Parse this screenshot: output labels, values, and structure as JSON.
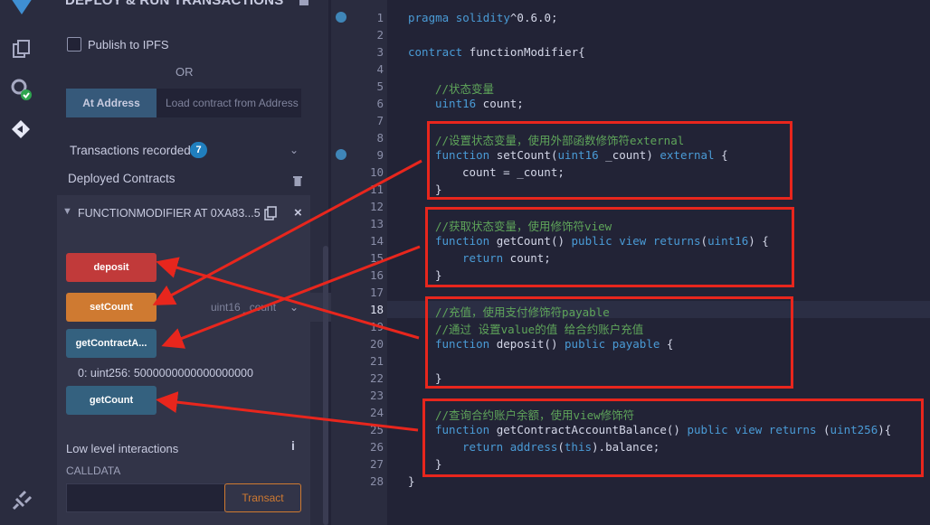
{
  "panel": {
    "title": "DEPLOY & RUN TRANSACTIONS",
    "publish_label": "Publish to IPFS",
    "or_label": "OR",
    "at_address_label": "At Address",
    "load_placeholder": "Load contract from Address",
    "transactions_label": "Transactions recorded",
    "transactions_count": "7",
    "deployed_label": "Deployed Contracts",
    "instance_title": "FUNCTIONMODIFIER AT 0XA83...5",
    "buttons": {
      "deposit": "deposit",
      "setCount": "setCount",
      "setCount_placeholder": "uint16 _count",
      "getContractBalance": "getContractA...",
      "getContractBalance_result": "0: uint256: 5000000000000000000",
      "getCount": "getCount"
    },
    "low_level_label": "Low level interactions",
    "calldata_label": "CALLDATA",
    "transact_label": "Transact"
  },
  "editor": {
    "active_line": 18,
    "line_numbers": [
      "1",
      "2",
      "3",
      "4",
      "5",
      "6",
      "7",
      "8",
      "9",
      "10",
      "11",
      "12",
      "13",
      "14",
      "15",
      "16",
      "17",
      "18",
      "19",
      "20",
      "21",
      "22",
      "23",
      "24",
      "25",
      "26",
      "27",
      "28"
    ],
    "lines": {
      "l1": "pragma solidity^0.6.0;",
      "l3": "contract functionModifier{",
      "l5": "//状态变量",
      "l6": "uint16 count;",
      "l8": "//设置状态变量，使用外部函数修饰符external",
      "l9": "function setCount(uint16 _count) external {",
      "l10": "count = _count;",
      "l11": "}",
      "l13": "//获取状态变量，使用修饰符view",
      "l14": "function getCount() public view returns(uint16) {",
      "l15": "return count;",
      "l16": "}",
      "l18": "//充值，使用支付修饰符payable",
      "l19": "//通过 设置value的值 给合约账户充值",
      "l20": "function deposit() public payable {",
      "l22": "}",
      "l24": "//查询合约账户余额，使用view修饰符",
      "l25": "function getContractAccountBalance() public view returns (uint256){",
      "l26": "return address(this).balance;",
      "l27": "}",
      "l28": "}"
    }
  },
  "colors": {
    "annotation": "#e8261d",
    "keyword": "#4a9bd6",
    "comment": "#5fa55a"
  }
}
